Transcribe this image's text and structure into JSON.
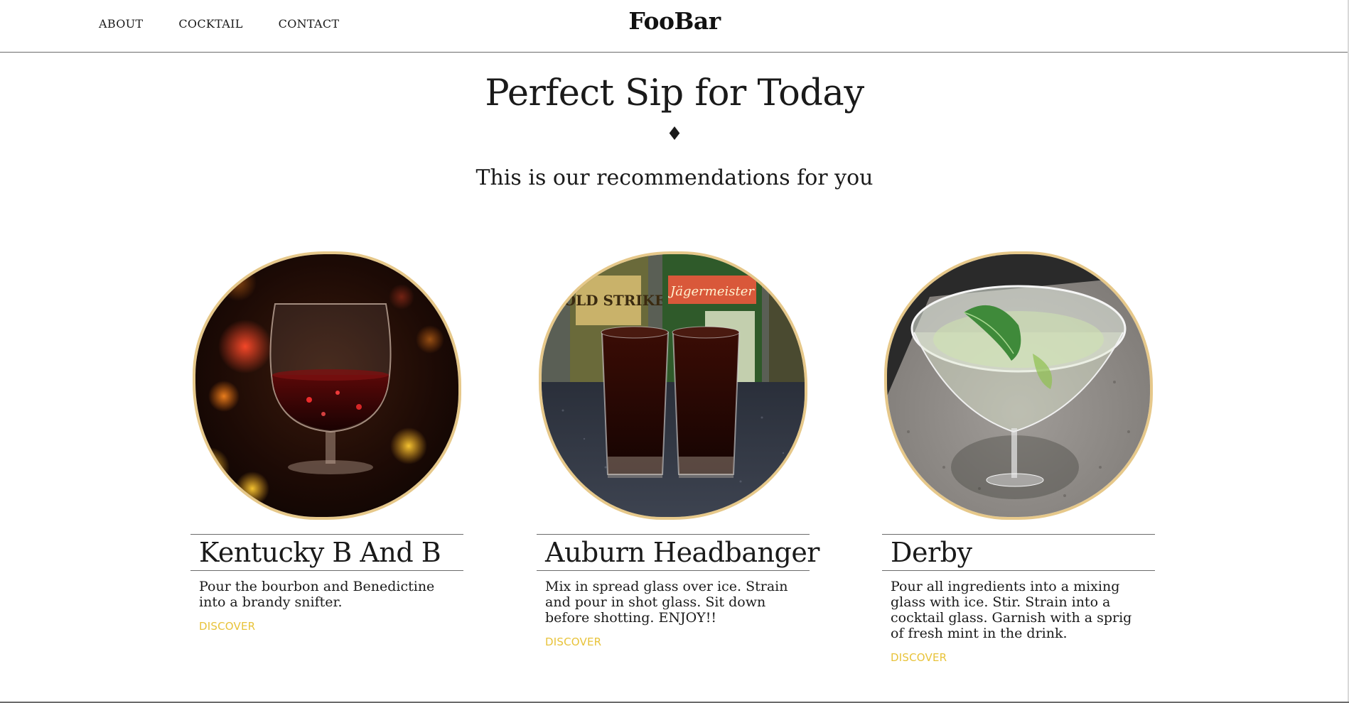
{
  "nav": {
    "links": [
      "ABOUT",
      "COCKTAIL",
      "CONTACT"
    ],
    "brand": "FooBar"
  },
  "hero": {
    "title": "Perfect Sip for Today",
    "ornament": "♦",
    "subtitle": "This is our recommendations for you"
  },
  "cards": [
    {
      "title": "Kentucky B And B",
      "description": "Pour the bourbon and Benedictine into a brandy snifter.",
      "link": "DISCOVER",
      "image": "brandy-snifter-photo"
    },
    {
      "title": "Auburn Headbanger",
      "description": "Mix in spread glass over ice. Strain and pour in shot glass. Sit down before shotting. ENJOY!!",
      "link": "DISCOVER",
      "image": "shot-glasses-photo",
      "bottle_labels": [
        "GOLD STRIKE",
        "Jägermeister"
      ]
    },
    {
      "title": "Derby",
      "description": "Pour all ingredients into a mixing glass with ice. Stir. Strain into a cocktail glass. Garnish with a sprig of fresh mint in the drink.",
      "link": "DISCOVER",
      "image": "martini-glass-mint-photo"
    }
  ],
  "colors": {
    "accent_gold": "#e8c33a",
    "image_border": "#e6c88a",
    "divider": "#6b6b6b",
    "text": "#1a1a1a"
  }
}
